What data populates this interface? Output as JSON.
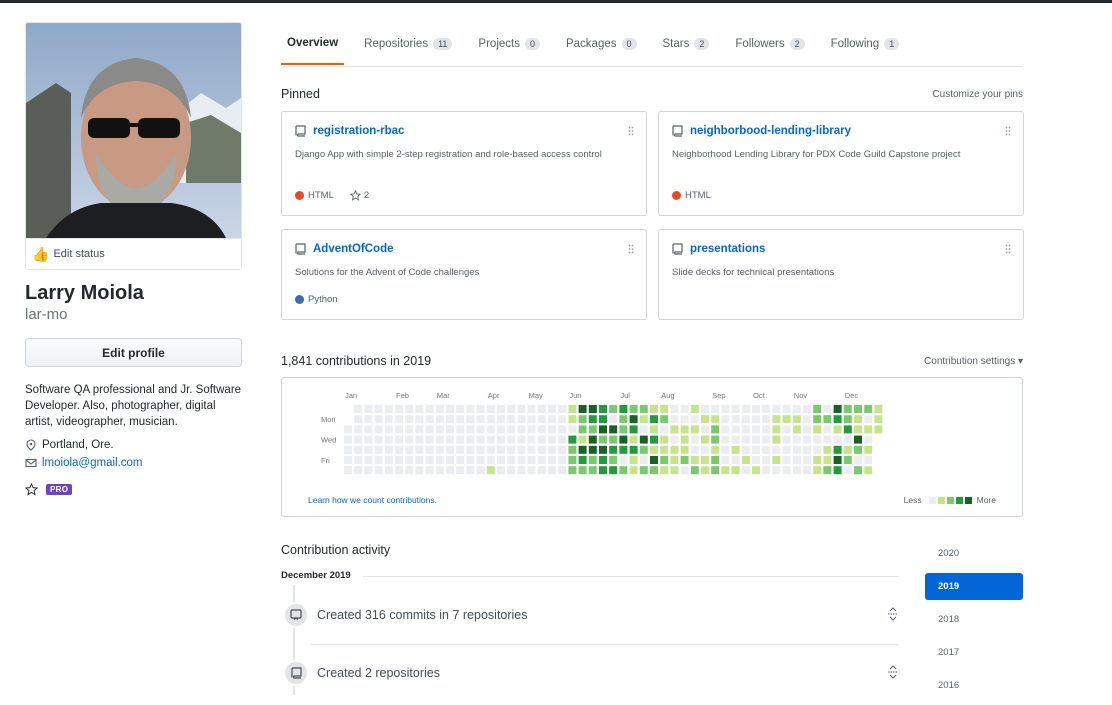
{
  "profile": {
    "edit_status": "Edit status",
    "name": "Larry Moiola",
    "login": "lar-mo",
    "edit_profile": "Edit profile",
    "bio": "Software QA professional and Jr. Software Developer. Also, photographer, digital artist, videographer, musician.",
    "location": "Portland, Ore.",
    "email": "lmoiola@gmail.com",
    "pro_badge": "PRO"
  },
  "tabs": [
    {
      "label": "Overview",
      "count": ""
    },
    {
      "label": "Repositories",
      "count": "11"
    },
    {
      "label": "Projects",
      "count": "0"
    },
    {
      "label": "Packages",
      "count": "0"
    },
    {
      "label": "Stars",
      "count": "2"
    },
    {
      "label": "Followers",
      "count": "2"
    },
    {
      "label": "Following",
      "count": "1"
    }
  ],
  "pinned": {
    "heading": "Pinned",
    "customize": "Customize your pins",
    "repos": [
      {
        "name": "registration-rbac",
        "desc": "Django App with simple 2-step registration and role-based access control",
        "lang": "HTML",
        "lang_color": "#e34c26",
        "stars": "2"
      },
      {
        "name": "neighborbood-lending-library",
        "desc": "Neighborhood Lending Library for PDX Code Guild Capstone project",
        "lang": "HTML",
        "lang_color": "#e34c26",
        "stars": ""
      },
      {
        "name": "AdventOfCode",
        "desc": "Solutions for the Advent of Code challenges",
        "lang": "Python",
        "lang_color": "#3572A5",
        "stars": ""
      },
      {
        "name": "presentations",
        "desc": "Slide decks for technical presentations",
        "lang": "",
        "lang_color": "",
        "stars": ""
      }
    ]
  },
  "contributions": {
    "heading": "1,841 contributions in 2019",
    "settings": "Contribution settings ▾",
    "months": [
      "Jan",
      "Feb",
      "Mar",
      "Apr",
      "May",
      "Jun",
      "Jul",
      "Aug",
      "Sep",
      "Oct",
      "Nov",
      "Dec"
    ],
    "days": [
      "Mon",
      "Wed",
      "Fri"
    ],
    "learn": "Learn how we count contributions.",
    "less": "Less",
    "more": "More",
    "colors": [
      "#ebedf0",
      "#c6e48b",
      "#7bc96f",
      "#239a3b",
      "#196127"
    ]
  },
  "activity": {
    "heading": "Contribution activity",
    "month": "December 2019",
    "items": [
      {
        "text": "Created 316 commits in 7 repositories"
      },
      {
        "text": "Created 2 repositories"
      }
    ]
  },
  "years": [
    "2020",
    "2019",
    "2018",
    "2017",
    "2016"
  ],
  "selected_year": "2019"
}
